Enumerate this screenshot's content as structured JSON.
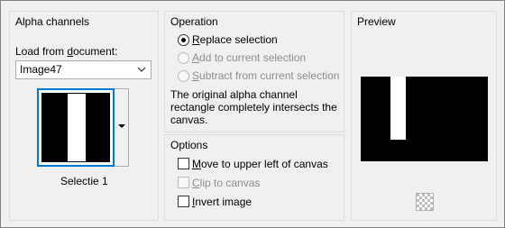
{
  "alpha_channels": {
    "title": "Alpha channels",
    "load_from_label_pre": "Load from ",
    "load_from_label_accel": "d",
    "load_from_label_post": "ocument:",
    "document_selected": "Image47",
    "selection_name": "Selectie 1"
  },
  "operation": {
    "title": "Operation",
    "options": [
      {
        "accel": "R",
        "rest": "eplace selection",
        "checked": true,
        "enabled": true
      },
      {
        "accel": "A",
        "rest": "dd to current selection",
        "checked": false,
        "enabled": false
      },
      {
        "accel": "S",
        "rest": "ubtract from current selection",
        "checked": false,
        "enabled": false
      }
    ],
    "description": "The original alpha channel rectangle completely intersects the canvas."
  },
  "options": {
    "title": "Options",
    "items": [
      {
        "accel": "M",
        "rest": "ove to upper left of canvas",
        "checked": false,
        "enabled": true
      },
      {
        "accel": "C",
        "rest": "lip to canvas",
        "checked": false,
        "enabled": false
      },
      {
        "accel": "I",
        "rest": "nvert image",
        "checked": false,
        "enabled": true
      }
    ]
  },
  "preview": {
    "title": "Preview"
  },
  "colors": {
    "focus_border": "#0078d7",
    "mask_black": "#000000",
    "mask_white": "#ffffff"
  },
  "icons": {
    "dropdown": "chevron-down-icon",
    "thumbnail_dropdown": "triangle-down-icon",
    "checker": "transparency-checkerboard-icon"
  }
}
